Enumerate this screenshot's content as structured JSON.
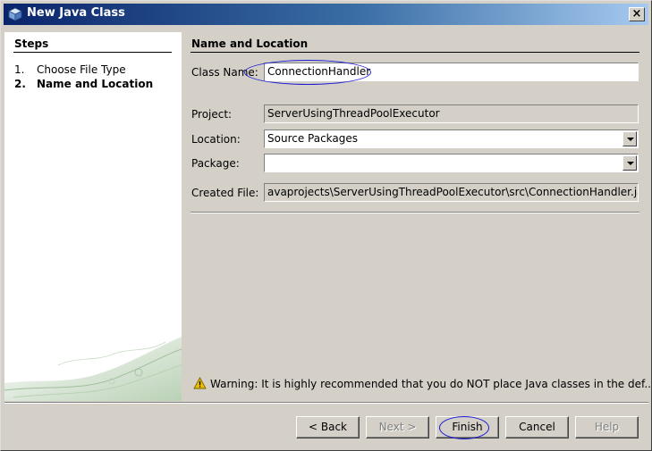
{
  "window": {
    "title": "New Java Class",
    "close_label": "×"
  },
  "steps": {
    "title": "Steps",
    "items": [
      {
        "num": "1.",
        "label": "Choose File Type"
      },
      {
        "num": "2.",
        "label": "Name and Location"
      }
    ]
  },
  "main": {
    "section_title": "Name and Location",
    "class_name": {
      "label": "Class Name:",
      "value": "ConnectionHandler"
    },
    "project": {
      "label": "Project:",
      "value": "ServerUsingThreadPoolExecutor"
    },
    "location": {
      "label": "Location:",
      "value": "Source Packages"
    },
    "package": {
      "label": "Package:",
      "value": ""
    },
    "created_file": {
      "label": "Created File:",
      "value": "avaprojects\\ServerUsingThreadPoolExecutor\\src\\ConnectionHandler.java"
    },
    "warning": "Warning: It is highly recommended that you do NOT place Java classes in the def..."
  },
  "buttons": {
    "back": "< Back",
    "next": "Next >",
    "finish": "Finish",
    "cancel": "Cancel",
    "help": "Help"
  },
  "colors": {
    "title_gradient_start": "#0a246a",
    "title_gradient_end": "#a6caf0",
    "annotation_ellipse": "#1a1ad6",
    "warning_icon": "#e8c000"
  },
  "icons": {
    "title": "java-class-cube-icon",
    "warning": "warning-triangle-icon",
    "combo": "chevron-down-icon"
  }
}
